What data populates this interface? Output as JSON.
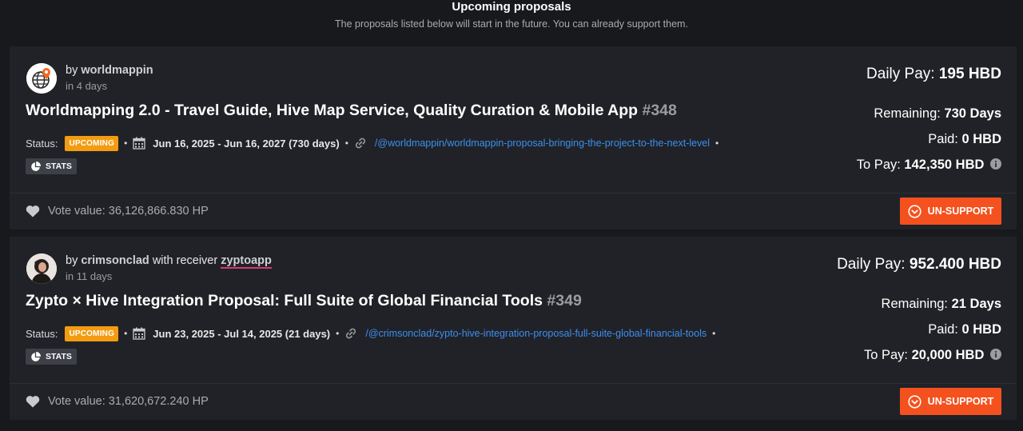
{
  "header": {
    "title": "Upcoming proposals",
    "subtitle": "The proposals listed below will start in the future. You can already support them."
  },
  "colors": {
    "accent": "#f4511e",
    "badge_upcoming": "#f39c12",
    "link": "#3b8ff0",
    "card_bg": "#212227",
    "page_bg": "#18191c"
  },
  "proposals": [
    {
      "by": "by",
      "author": "worldmappin",
      "receiver_text": "",
      "receiver": "",
      "starts_in": "in 4 days",
      "title": "Worldmapping 2.0 - Travel Guide, Hive Map Service, Quality Curation & Mobile App",
      "number": "#348",
      "status_label": "Status:",
      "status": "UPCOMING",
      "dates": "Jun 16, 2025 - Jun 16, 2027 (730 days)",
      "link": "/@worldmappin/worldmappin-proposal-bringing-the-project-to-the-next-level",
      "stats_label": "STATS",
      "daily_pay_label": "Daily Pay:",
      "daily_pay": "195 HBD",
      "remaining_label": "Remaining:",
      "remaining": "730 Days",
      "paid_label": "Paid:",
      "paid": "0 HBD",
      "to_pay_label": "To Pay:",
      "to_pay": "142,350 HBD",
      "vote_label": "Vote value:",
      "vote_value": "36,126,866.830 HP",
      "button": "UN-SUPPORT",
      "avatar_icon": "globe-pin-icon"
    },
    {
      "by": "by",
      "author": "crimsonclad",
      "receiver_text": "with receiver",
      "receiver": "zyptoapp",
      "starts_in": "in 11 days",
      "title": "Zypto × Hive Integration Proposal: Full Suite of Global Financial Tools",
      "number": "#349",
      "status_label": "Status:",
      "status": "UPCOMING",
      "dates": "Jun 23, 2025 - Jul 14, 2025 (21 days)",
      "link": "/@crimsonclad/zypto-hive-integration-proposal-full-suite-global-financial-tools",
      "stats_label": "STATS",
      "daily_pay_label": "Daily Pay:",
      "daily_pay": "952.400 HBD",
      "remaining_label": "Remaining:",
      "remaining": "21 Days",
      "paid_label": "Paid:",
      "paid": "0 HBD",
      "to_pay_label": "To Pay:",
      "to_pay": "20,000 HBD",
      "vote_label": "Vote value:",
      "vote_value": "31,620,672.240 HP",
      "button": "UN-SUPPORT",
      "avatar_icon": "user-photo-icon"
    }
  ]
}
